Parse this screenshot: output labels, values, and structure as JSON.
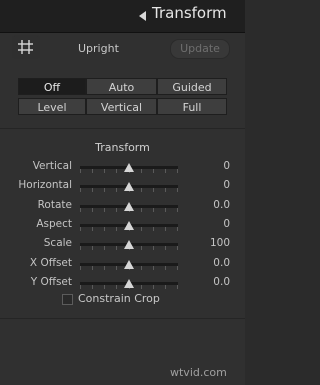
{
  "header": {
    "title": "Transform"
  },
  "upright": {
    "label": "Upright",
    "update_label": "Update",
    "modes_row1": [
      "Off",
      "Auto",
      "Guided"
    ],
    "modes_row2": [
      "Level",
      "Vertical",
      "Full"
    ],
    "active_mode": "Off"
  },
  "transform": {
    "title": "Transform",
    "sliders": [
      {
        "label": "Vertical",
        "value": "0",
        "position": 0.5
      },
      {
        "label": "Horizontal",
        "value": "0",
        "position": 0.5
      },
      {
        "label": "Rotate",
        "value": "0.0",
        "position": 0.5
      },
      {
        "label": "Aspect",
        "value": "0",
        "position": 0.5
      },
      {
        "label": "Scale",
        "value": "100",
        "position": 0.5
      },
      {
        "label": "X Offset",
        "value": "0.0",
        "position": 0.5
      },
      {
        "label": "Y Offset",
        "value": "0.0",
        "position": 0.5
      }
    ],
    "constrain_crop": {
      "label": "Constrain Crop",
      "checked": false
    }
  },
  "watermark": "wtvid.com",
  "icons": {
    "collapse": "triangle-left-icon",
    "crop_tool": "crop-guide-icon"
  }
}
